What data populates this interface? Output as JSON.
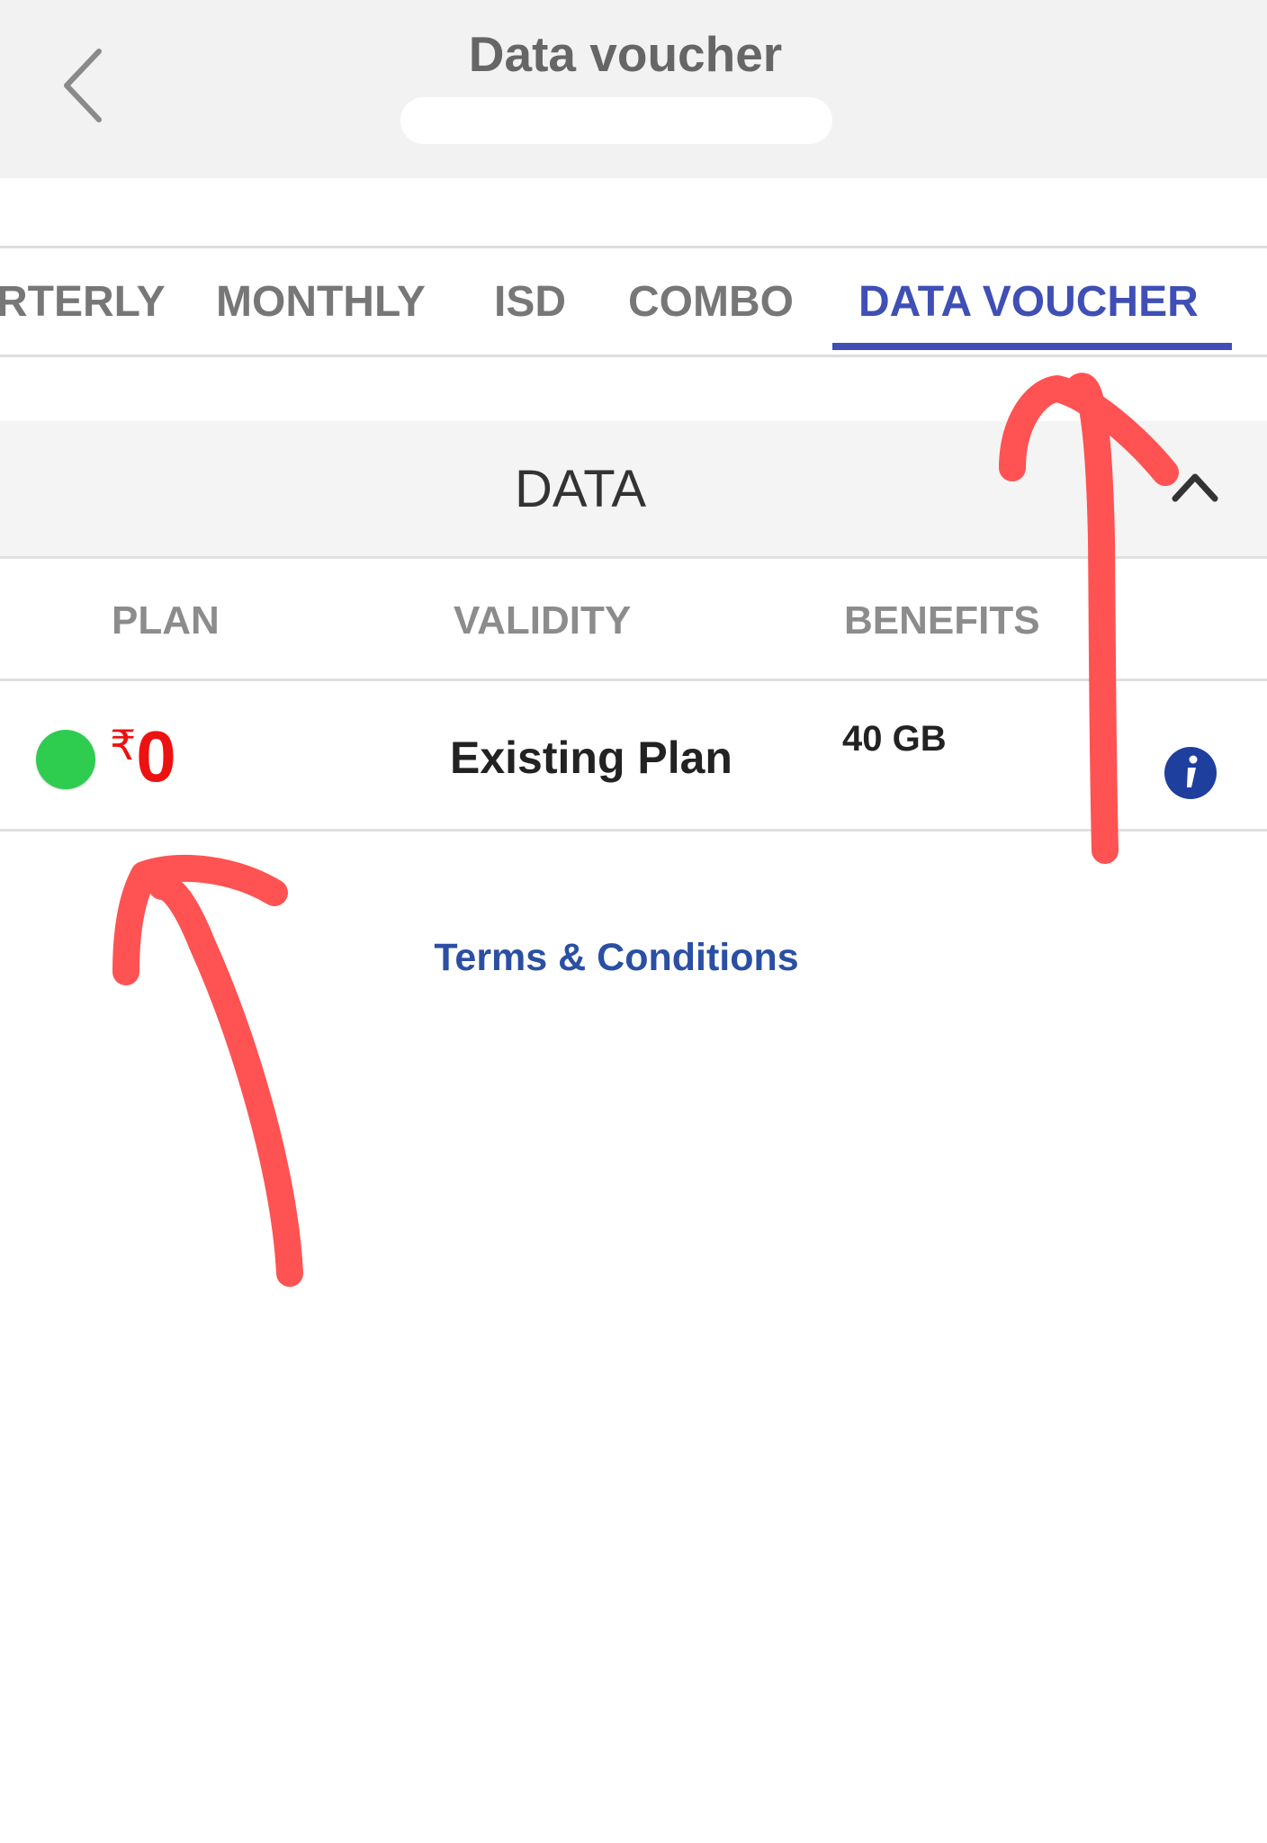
{
  "header": {
    "title": "Data voucher",
    "subtitle_redacted": true
  },
  "tabs": [
    {
      "label": "RTERLY",
      "active": false
    },
    {
      "label": "MONTHLY",
      "active": false
    },
    {
      "label": "ISD",
      "active": false
    },
    {
      "label": "COMBO",
      "active": false
    },
    {
      "label": "DATA VOUCHER",
      "active": true
    }
  ],
  "section": {
    "title": "DATA",
    "expanded": true
  },
  "columns": {
    "plan": "PLAN",
    "validity": "VALIDITY",
    "benefits": "BENEFITS"
  },
  "plans": [
    {
      "currency": "₹",
      "price": "0",
      "validity": "Existing Plan",
      "benefits": "40 GB",
      "selected": true
    }
  ],
  "footer": {
    "terms_label": "Terms & Conditions"
  },
  "colors": {
    "accent": "#3f4fb5",
    "price": "#ee1111",
    "selected_dot": "#2ecc4f",
    "annotation": "#ff5252",
    "link": "#2a4fa3"
  },
  "icons": {
    "back": "chevron-left-icon",
    "collapse": "chevron-up-icon",
    "info": "info-icon"
  }
}
